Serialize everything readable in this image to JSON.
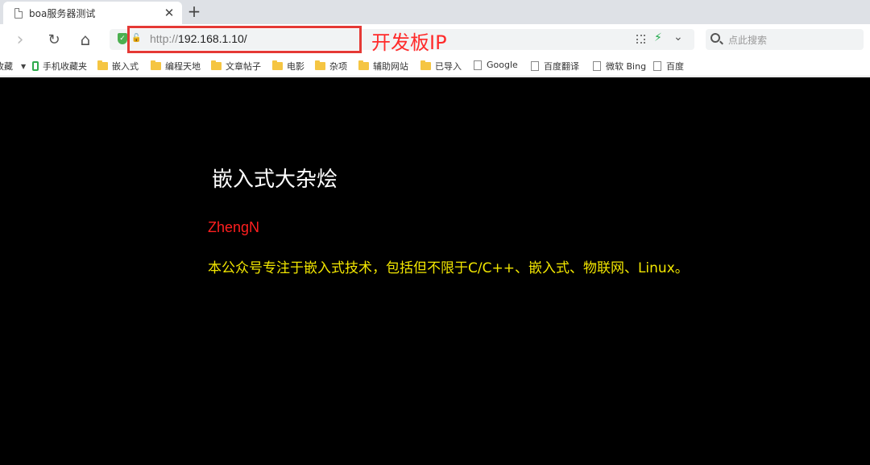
{
  "tab": {
    "title": "boa服务器测试",
    "close": "✕",
    "new_tab": "+"
  },
  "toolbar": {
    "back": "›",
    "reload": "↻",
    "home": "⌂",
    "url_scheme": "http://",
    "url_host": "192.168.1.10/",
    "annotation": "开发板IP",
    "search_placeholder": "点此搜索"
  },
  "bookmarks": {
    "items": [
      {
        "label": "收藏",
        "type": "menu"
      },
      {
        "label": "手机收藏夹",
        "type": "phone"
      },
      {
        "label": "嵌入式",
        "type": "folder"
      },
      {
        "label": "编程天地",
        "type": "folder"
      },
      {
        "label": "文章帖子",
        "type": "folder"
      },
      {
        "label": "电影",
        "type": "folder"
      },
      {
        "label": "杂项",
        "type": "folder"
      },
      {
        "label": "辅助网站",
        "type": "folder"
      },
      {
        "label": "已导入",
        "type": "folder"
      },
      {
        "label": "Google",
        "type": "page"
      },
      {
        "label": "百度翻译",
        "type": "page"
      },
      {
        "label": "微软 Bing",
        "type": "page"
      },
      {
        "label": "百度",
        "type": "page"
      }
    ]
  },
  "page": {
    "heading": "嵌入式大杂烩",
    "author": "ZhengN",
    "description": "本公众号专注于嵌入式技术，包括但不限于C/C++、嵌入式、物联网、Linux。"
  },
  "colors": {
    "heading": "#ffffff",
    "author": "#ff1f1f",
    "description": "#f2e600",
    "highlight": "#e53935"
  }
}
